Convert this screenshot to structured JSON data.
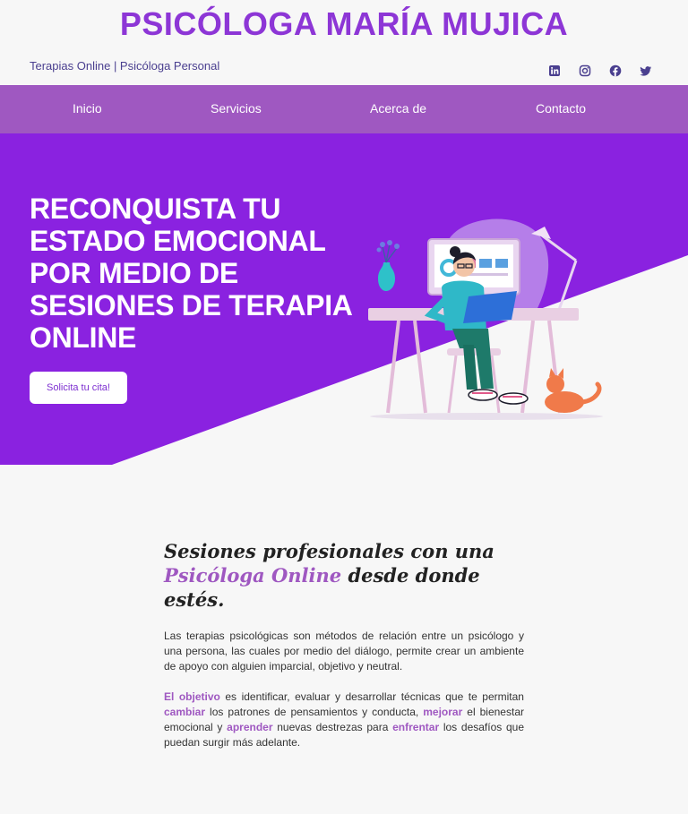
{
  "header": {
    "site_title": "PSICÓLOGA MARÍA MUJICA",
    "tagline": "Terapias Online | Psicóloga Personal",
    "social_icons": [
      "linkedin-icon",
      "instagram-icon",
      "facebook-icon",
      "twitter-icon"
    ]
  },
  "nav": {
    "items": [
      {
        "label": "Inicio"
      },
      {
        "label": "Servicios"
      },
      {
        "label": "Acerca de"
      },
      {
        "label": "Contacto"
      }
    ]
  },
  "hero": {
    "title": "RECONQUISTA TU ESTADO EMOCIONAL POR MEDIO DE SESIONES DE TERAPIA ONLINE",
    "cta_label": "Solicita tu cita!"
  },
  "intro": {
    "heading_part1": "Sesiones profesionales con una",
    "heading_highlight": "Psicóloga Online",
    "heading_part2": "desde donde estés.",
    "paragraph1": "Las terapias psicológicas son métodos de relación entre un psicólogo y una persona, las cuales por medio del diálogo, permite crear un ambiente de apoyo con alguien imparcial, objetivo y neutral.",
    "p2": {
      "kw1": "El objetivo",
      "t1": " es identificar, evaluar y desarrollar técnicas que te permitan ",
      "kw2": "cambiar",
      "t2": " los patrones de pensamientos y conducta, ",
      "kw3": "mejorar",
      "t3": " el bienestar emocional y ",
      "kw4": "aprender",
      "t4": " nuevas destrezas para ",
      "kw5": "enfrentar",
      "t5": " los desafíos que puedan surgir más adelante."
    }
  },
  "colors": {
    "brand_purple": "#8d36d6",
    "nav_bg": "#9f58c1",
    "hero_bg": "#8a22e0",
    "accent": "#9f58c1"
  }
}
